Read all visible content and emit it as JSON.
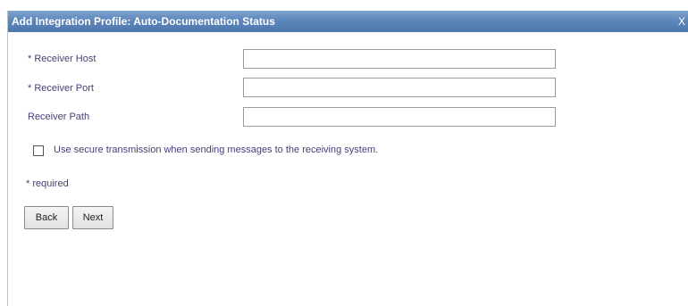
{
  "dialog": {
    "title": "Add Integration Profile: Auto-Documentation Status",
    "close_label": "X"
  },
  "form": {
    "receiver_host": {
      "label": "* Receiver Host",
      "value": ""
    },
    "receiver_port": {
      "label": "* Receiver Port",
      "value": ""
    },
    "receiver_path": {
      "label": "Receiver Path",
      "value": ""
    },
    "secure_transmission": {
      "label": "Use secure transmission when sending messages to the receiving system.",
      "checked": false
    },
    "required_note": "* required"
  },
  "buttons": {
    "back_label": "Back",
    "next_label": "Next"
  },
  "colors": {
    "titlebar": "#5d86bb",
    "label_text": "#4a3b78"
  }
}
